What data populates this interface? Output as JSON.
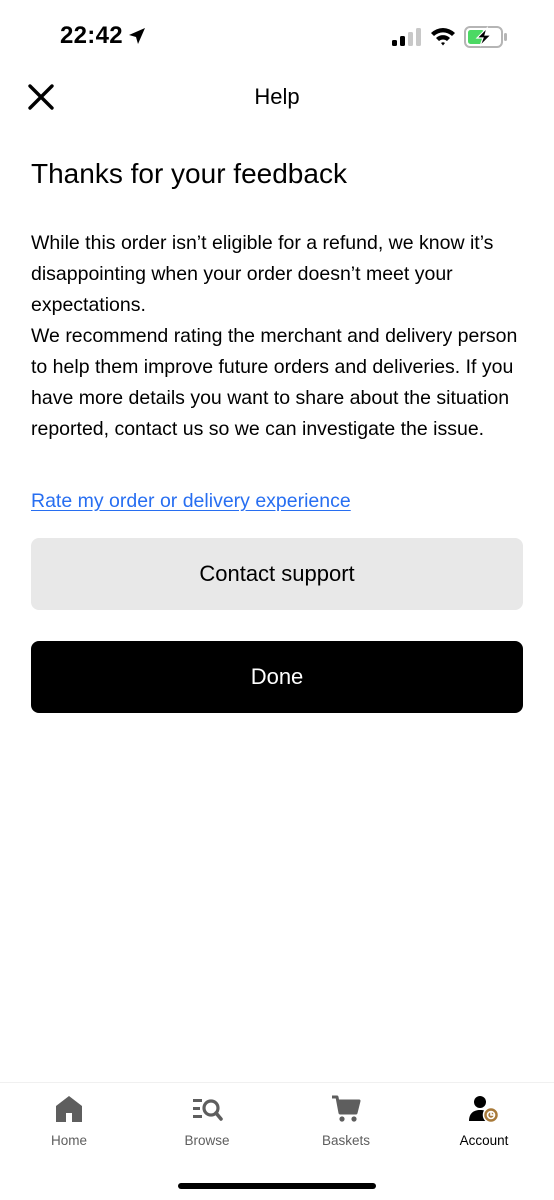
{
  "status_bar": {
    "time": "22:42"
  },
  "header": {
    "title": "Help"
  },
  "content": {
    "title": "Thanks for your feedback",
    "paragraph_1": "While this order isn’t eligible for a refund, we know it’s disappointing when your order doesn’t meet your expectations.",
    "paragraph_2": "We recommend rating the merchant and delivery person to help them improve future orders and deliveries. If you have more details you want to share about the situation reported, contact us so we can investigate the issue.",
    "rate_link": "Rate my order or delivery experience",
    "contact_button": "Contact support",
    "done_button": "Done"
  },
  "tabs": [
    {
      "label": "Home",
      "icon": "home-icon",
      "active": false
    },
    {
      "label": "Browse",
      "icon": "browse-icon",
      "active": false
    },
    {
      "label": "Baskets",
      "icon": "cart-icon",
      "active": false
    },
    {
      "label": "Account",
      "icon": "account-icon",
      "active": true
    }
  ],
  "colors": {
    "link": "#276ef1",
    "primary_button": "#000000",
    "secondary_button": "#e8e8e8",
    "battery_fill": "#4cd964"
  }
}
